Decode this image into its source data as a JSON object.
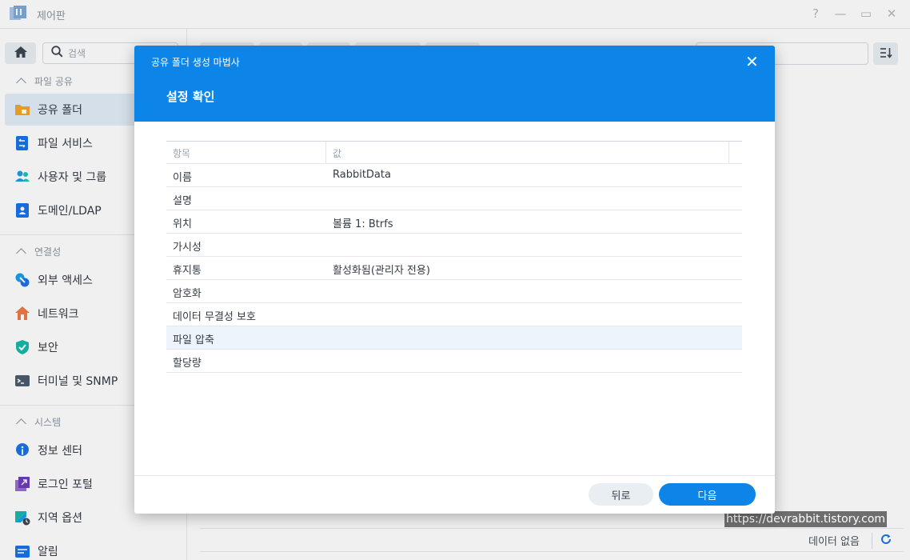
{
  "window": {
    "title": "제어판",
    "help": "?",
    "minimize": "—",
    "maximize": "▭",
    "close": "✕"
  },
  "sidebar": {
    "search_placeholder": "검색",
    "sections": [
      {
        "label": "파일 공유",
        "items": [
          {
            "label": "공유 폴더",
            "icon": "shared-folder-icon",
            "active": true
          },
          {
            "label": "파일 서비스",
            "icon": "file-services-icon"
          },
          {
            "label": "사용자 및 그룹",
            "icon": "user-group-icon"
          },
          {
            "label": "도메인/LDAP",
            "icon": "domain-ldap-icon"
          }
        ]
      },
      {
        "label": "연결성",
        "items": [
          {
            "label": "외부 액세스",
            "icon": "external-access-icon"
          },
          {
            "label": "네트워크",
            "icon": "network-icon"
          },
          {
            "label": "보안",
            "icon": "security-shield-icon"
          },
          {
            "label": "터미널 및 SNMP",
            "icon": "terminal-icon"
          }
        ]
      },
      {
        "label": "시스템",
        "items": [
          {
            "label": "정보 센터",
            "icon": "info-center-icon"
          },
          {
            "label": "로그인 포털",
            "icon": "login-portal-icon"
          },
          {
            "label": "지역 옵션",
            "icon": "regional-options-icon"
          },
          {
            "label": "알림",
            "icon": "notification-icon"
          }
        ]
      }
    ]
  },
  "main": {
    "status_text": "데이터 없음",
    "refresh": "C",
    "watermark": "https://devrabbit.tistory.com"
  },
  "dialog": {
    "title": "공유 폴더 생성 마법사",
    "close": "✕",
    "step_title": "설정 확인",
    "table": {
      "headers": [
        "항목",
        "값"
      ],
      "rows": [
        {
          "item": "이름",
          "value": "RabbitData"
        },
        {
          "item": "설명",
          "value": ""
        },
        {
          "item": "위치",
          "value": "볼륨 1: Btrfs"
        },
        {
          "item": "가시성",
          "value": ""
        },
        {
          "item": "휴지통",
          "value": "활성화됨(관리자 전용)"
        },
        {
          "item": "암호화",
          "value": ""
        },
        {
          "item": "데이터 무결성 보호",
          "value": ""
        },
        {
          "item": "파일 압축",
          "value": ""
        },
        {
          "item": "할당량",
          "value": ""
        }
      ]
    },
    "back_button": "뒤로",
    "next_button": "다음"
  },
  "colors": {
    "accent": "#0c84e8",
    "sidebar_active": "#e3edf8"
  }
}
